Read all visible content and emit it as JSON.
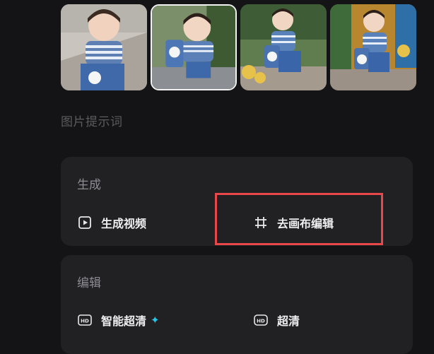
{
  "thumbnails": [
    {
      "alt": "",
      "selected": false
    },
    {
      "alt": "",
      "selected": true
    },
    {
      "alt": "",
      "selected": false
    },
    {
      "alt": "",
      "selected": false
    }
  ],
  "prompt_section": {
    "label": "图片提示词"
  },
  "generate_card": {
    "title": "生成",
    "actions": [
      {
        "label": "生成视频",
        "icon": "play-icon"
      },
      {
        "label": "去画布编辑",
        "icon": "crop-icon"
      }
    ]
  },
  "edit_card": {
    "title": "编辑",
    "actions": [
      {
        "label": "智能超清",
        "icon": "hd-plus-icon",
        "badge_icon": "sparkle-icon"
      },
      {
        "label": "超清",
        "icon": "hd-icon"
      }
    ]
  },
  "colors": {
    "background": "#141416",
    "card": "#212124",
    "highlight": "#e8484a",
    "sparkle": "#28c6e6"
  }
}
